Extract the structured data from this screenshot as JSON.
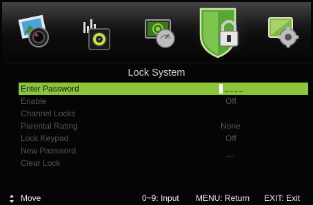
{
  "title": "Lock System",
  "tabs": [
    {
      "name": "picture",
      "icon": "picture-icon"
    },
    {
      "name": "sound",
      "icon": "sound-icon"
    },
    {
      "name": "channel",
      "icon": "channel-icon"
    },
    {
      "name": "lock",
      "icon": "lock-icon",
      "selected": true
    },
    {
      "name": "setup",
      "icon": "setup-icon"
    }
  ],
  "menu": {
    "enter_password": {
      "label": "Enter Password"
    },
    "enable": {
      "label": "Enable",
      "value": "Off"
    },
    "channel_locks": {
      "label": "Channel Locks"
    },
    "parental_rating": {
      "label": "Parental Rating",
      "value": "None"
    },
    "lock_keypad": {
      "label": "Lock Keypad",
      "value": "Off"
    },
    "new_password": {
      "label": "New Password",
      "value": "----"
    },
    "clear_lock": {
      "label": "Clear Lock"
    }
  },
  "footer": {
    "move": "Move",
    "input": "0~9: Input",
    "menu_return": "MENU: Return",
    "exit": "EXIT: Exit"
  },
  "colors": {
    "highlight": "#8bc63a",
    "background": "#050505"
  }
}
